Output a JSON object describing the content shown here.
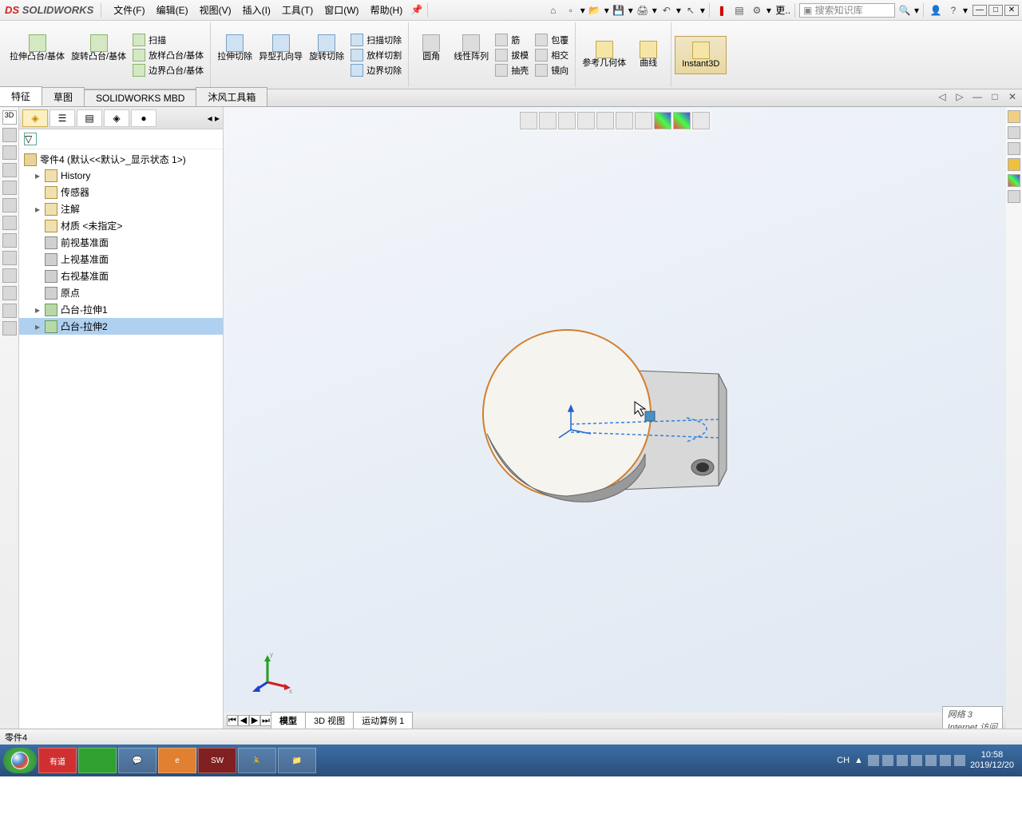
{
  "title": "SOLIDWORKS",
  "menus": [
    "文件(F)",
    "编辑(E)",
    "视图(V)",
    "插入(I)",
    "工具(T)",
    "窗口(W)",
    "帮助(H)"
  ],
  "search_placeholder": "搜索知识库",
  "ribbon": {
    "extrude": "拉伸凸台/基体",
    "revolve": "旋转凸台/基体",
    "sweep": "扫描",
    "loft": "放样凸台/基体",
    "boundary": "边界凸台/基体",
    "extrudecut": "拉伸切除",
    "holewiz": "异型孔向导",
    "revcut": "旋转切除",
    "sweepcut": "扫描切除",
    "loftcut": "放样切割",
    "boundcut": "边界切除",
    "fillet": "圆角",
    "linpat": "线性阵列",
    "rib": "筋",
    "draft": "拔模",
    "shell": "抽壳",
    "wrap": "包覆",
    "intersect": "相交",
    "mirror": "镜向",
    "refgeom": "参考几何体",
    "curves": "曲线",
    "instant3d": "Instant3D"
  },
  "tabs": [
    "特征",
    "草图",
    "SOLIDWORKS MBD",
    "沐风工具箱"
  ],
  "tree": {
    "root": "零件4  (默认<<默认>_显示状态 1>)",
    "items": [
      {
        "label": "History",
        "icon": "folder",
        "expand": "▸"
      },
      {
        "label": "传感器",
        "icon": "folder",
        "expand": ""
      },
      {
        "label": "注解",
        "icon": "folder",
        "expand": "▸"
      },
      {
        "label": "材质 <未指定>",
        "icon": "folder",
        "expand": ""
      },
      {
        "label": "前视基准面",
        "icon": "plane",
        "expand": ""
      },
      {
        "label": "上视基准面",
        "icon": "plane",
        "expand": ""
      },
      {
        "label": "右视基准面",
        "icon": "plane",
        "expand": ""
      },
      {
        "label": "原点",
        "icon": "plane",
        "expand": ""
      },
      {
        "label": "凸台-拉伸1",
        "icon": "feat",
        "expand": "▸"
      },
      {
        "label": "凸台-拉伸2",
        "icon": "feat",
        "expand": "▸",
        "selected": true
      }
    ]
  },
  "bottom_tabs": [
    "模型",
    "3D 视图",
    "运动算例 1"
  ],
  "status": {
    "doc": "零件4",
    "net1": "网络  3",
    "net2": "Internet 访问"
  },
  "taskbar": {
    "items": [
      "有道",
      "",
      "",
      "",
      "",
      "SW",
      "",
      ""
    ],
    "lang": "CH",
    "time": "10:58",
    "date": "2019/12/20"
  }
}
